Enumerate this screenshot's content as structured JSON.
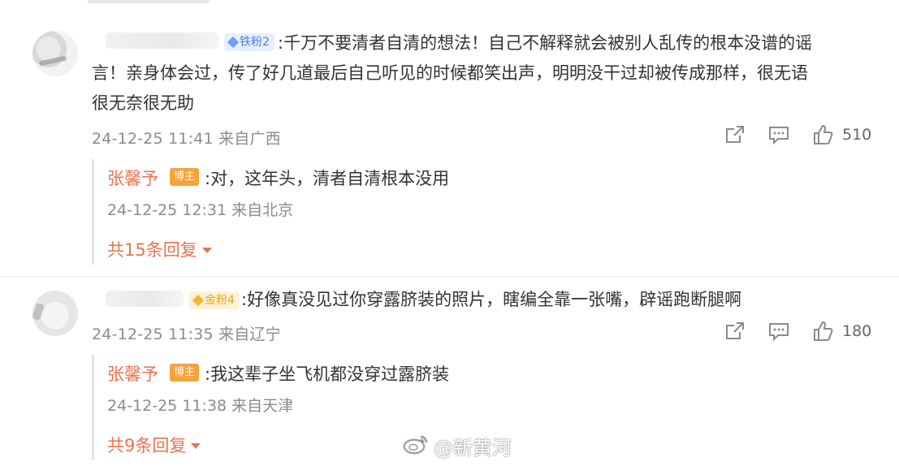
{
  "comments": [
    {
      "fan_badge": "铁粉2",
      "text_line1": ":千万不要清者自清的想法！自己不解释就会被别人乱传的根本没谱的谣",
      "text_line2": "言！亲身体会过，传了好几道最后自己听见的时候都笑出声，明明没干过却被传成那样，很无语",
      "text_line3": "很无奈很无助",
      "meta": "24-12-25 11:41 来自广西",
      "likes": "510",
      "reply": {
        "author": "张馨予",
        "badge": "博主",
        "text": ":对，这年头，清者自清根本没用",
        "meta": "24-12-25 12:31 来自北京",
        "more": "共15条回复"
      }
    },
    {
      "fan_badge": "金粉4",
      "text_line1": ":好像真没见过你穿露脐装的照片，瞎编全靠一张嘴，辟谣跑断腿啊",
      "meta": "24-12-25 11:35 来自辽宁",
      "likes": "180",
      "reply": {
        "author": "张馨予",
        "badge": "博主",
        "text": ":我这辈子坐飞机都没穿过露脐装",
        "meta": "24-12-25 11:38 来自天津",
        "more": "共9条回复"
      }
    }
  ],
  "watermark": "@新黄河",
  "icons": [
    "share-icon",
    "comment-icon",
    "like-icon",
    "weibo-logo-icon"
  ]
}
